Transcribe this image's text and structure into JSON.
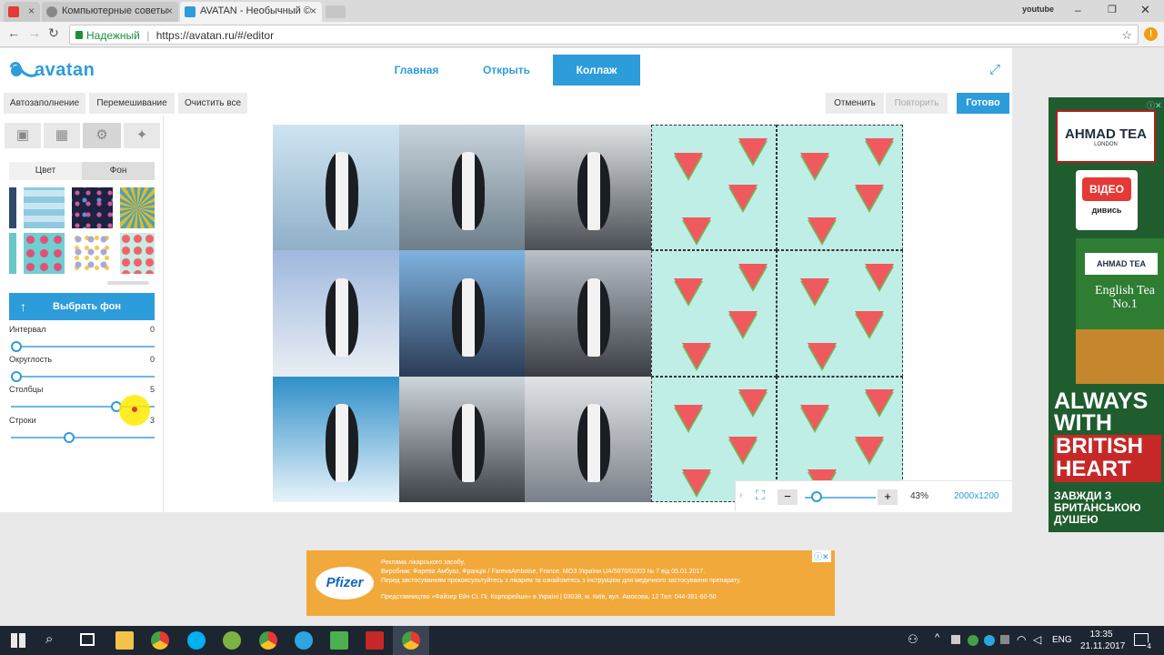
{
  "browser": {
    "tabs": [
      {
        "title": "",
        "icon": "youtube-icon",
        "color": "#e53935"
      },
      {
        "title": "Компьютерные советы",
        "icon": "globe-icon",
        "color": "#888888"
      },
      {
        "title": "AVATAN - Необычный ©",
        "icon": "avatan-icon",
        "color": "#2d9cdb"
      }
    ],
    "profile": "youtube",
    "secure_label": "Надежный",
    "url": "https://avatan.ru/#/editor"
  },
  "app": {
    "logo": "avatan",
    "nav": [
      "Главная",
      "Открыть",
      "Коллаж"
    ],
    "active_nav": "Коллаж",
    "toolbar_left": [
      "Автозаполнение",
      "Перемешивание",
      "Очистить все"
    ],
    "undo": "Отменить",
    "redo": "Повторить",
    "done": "Готово",
    "accent": "#2d9cdb"
  },
  "panel": {
    "tabs": [
      "image-icon",
      "grid-icon",
      "gear-icon",
      "star-icon"
    ],
    "subtabs": [
      "Цвет",
      "Фон"
    ],
    "active_subtab": "Фон",
    "choose_bg": "Выбрать фон",
    "sliders": [
      {
        "label": "Интервал",
        "value": "0",
        "level": 0.0
      },
      {
        "label": "Округлость",
        "value": "0",
        "level": 0.0
      },
      {
        "label": "Столбцы",
        "value": "5",
        "level": 0.75
      },
      {
        "label": "Строки",
        "value": "3",
        "level": 0.4
      }
    ]
  },
  "canvas": {
    "zoom": "43%",
    "size": "2000x1200",
    "zoom_level": 0.1
  },
  "ad_right": {
    "brand": "AHMAD TEA",
    "brand_sub": "LONDON",
    "video_btn": "ВІДЕО",
    "video_sub": "дивись",
    "pack_title": "English Tea No.1",
    "slogan": [
      "ALWAYS",
      "WITH",
      "BRITISH",
      "HEART"
    ],
    "footer": "ЗАВЖДИ З БРИТАНСЬКОЮ ДУШЕЮ"
  },
  "ad_bottom": {
    "brand": "Pfizer",
    "lines": [
      "Реклама лікарського засобу.",
      "Виробник: Фарева Амбуаз, Франція / FarevaAmboise, France. МОЗ України UA/5970/02/03 № 7  від 05.01.2017.",
      "Перед застосуванням проконсультуйтесь з лікарем та ознайомтесь з інструкцією для медичного застосування препарату.",
      "Представництво «Файзер Ейч Сі. Пі. Корпорейшн» в Україні | 03038, м. Київ, вул. Амосова, 12 Тел: 044-391-60-50"
    ]
  },
  "taskbar": {
    "lang": "ENG",
    "time": "13:35",
    "date": "21.11.2017",
    "notif_count": "4"
  }
}
